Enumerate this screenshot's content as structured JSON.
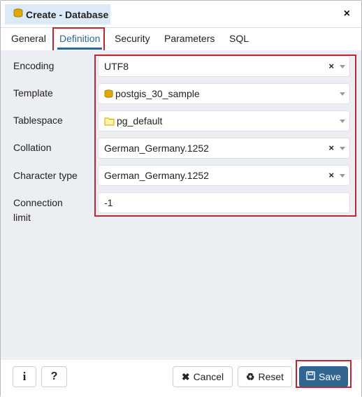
{
  "dialog": {
    "title": "Create - Database",
    "close_label": "×"
  },
  "tabs": [
    {
      "label": "General"
    },
    {
      "label": "Definition"
    },
    {
      "label": "Security"
    },
    {
      "label": "Parameters"
    },
    {
      "label": "SQL"
    }
  ],
  "active_tab": "Definition",
  "form": {
    "encoding": {
      "label": "Encoding",
      "value": "UTF8",
      "clear": "×"
    },
    "template": {
      "label": "Template",
      "value": "postgis_30_sample"
    },
    "tablespace": {
      "label": "Tablespace",
      "value": "pg_default"
    },
    "collation": {
      "label": "Collation",
      "value": "German_Germany.1252",
      "clear": "×"
    },
    "character_type": {
      "label": "Character type",
      "value": "German_Germany.1252",
      "clear": "×"
    },
    "connection_limit": {
      "label_line1": "Connection",
      "label_line2": "limit",
      "value": "-1"
    }
  },
  "footer": {
    "info_label": "i",
    "help_label": "?",
    "cancel_label": "Cancel",
    "reset_label": "Reset",
    "save_label": "Save"
  },
  "colors": {
    "accent": "#326690",
    "highlight": "#c0262d",
    "body_bg": "#ebeef3"
  },
  "icons": {
    "title": "database-icon",
    "template": "database-icon",
    "tablespace": "folder-icon",
    "cancel": "close-icon",
    "reset": "recycle-icon",
    "save": "floppy-disk-icon",
    "info": "info-icon",
    "help": "question-icon"
  }
}
